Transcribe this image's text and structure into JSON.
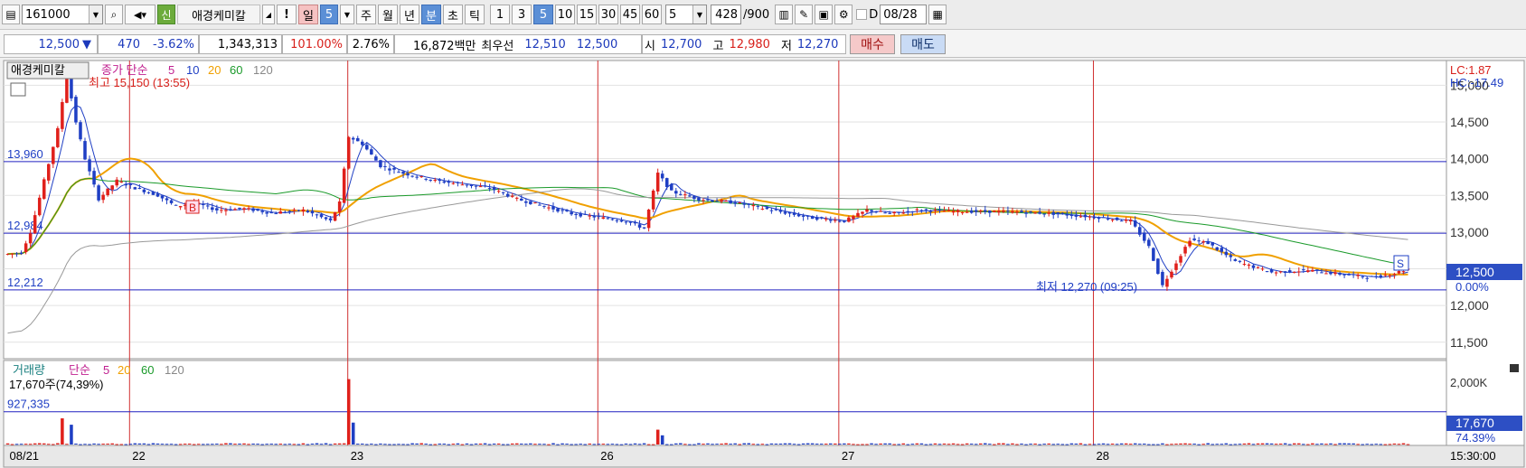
{
  "toolbar": {
    "stock_code": "161000",
    "stock_name": "애경케미칼",
    "badge_letter": "신",
    "alert": "!",
    "periods": [
      "일",
      "5",
      "주",
      "월",
      "년",
      "분",
      "초",
      "틱"
    ],
    "period_selected": "분",
    "intervals": [
      "1",
      "3",
      "5",
      "10",
      "15",
      "30",
      "45",
      "60"
    ],
    "interval_selected": "5",
    "count": "5",
    "range": "428",
    "range_total": "/900",
    "check_label": "D",
    "date": "08/28"
  },
  "quote": {
    "price": "12,500",
    "arrow": "▼",
    "change": "470",
    "change_pct": "-3.62%",
    "volume": "1,343,313",
    "vol_ratio": "101.00%",
    "turnover_pct": "2.76%",
    "amount": "16,872백만",
    "best_label": "최우선",
    "best_ask": "12,510",
    "best_bid": "12,500",
    "open_label": "시",
    "open": "12,700",
    "high_label": "고",
    "high": "12,980",
    "low_label": "저",
    "low": "12,270",
    "buy_label": "매수",
    "sell_label": "매도"
  },
  "chart_data": {
    "type": "candlestick",
    "legend_price": {
      "name": "애경케미칼",
      "ma_label": "종가 단순",
      "periods": [
        "5",
        "10",
        "20",
        "60",
        "120"
      ]
    },
    "legend_volume": {
      "name": "거래량",
      "ma_label": "단순",
      "periods": [
        "5",
        "20",
        "60",
        "120"
      ]
    },
    "volume_info": "17,670주(74,39%)",
    "ylim": [
      11300,
      15300
    ],
    "y_ticks": [
      11500,
      12000,
      12500,
      13000,
      13500,
      14000,
      14500,
      15000
    ],
    "y_tick_labels": [
      "11,500",
      "12,000",
      "12,500",
      "13,000",
      "13,500",
      "14,000",
      "14,500",
      "15,000"
    ],
    "vol_ylim": [
      0,
      2300000
    ],
    "vol_tick_label": "2,000K",
    "x_labels": [
      "08/21",
      "22",
      "23",
      "26",
      "27",
      "28"
    ],
    "time_label": "15:30:00",
    "h_lines": [
      {
        "value": 13960,
        "label": "13,960"
      },
      {
        "value": 12984,
        "label": "12,984"
      },
      {
        "value": 12212,
        "label": "12,212"
      }
    ],
    "vol_h_line": {
      "value": 927335,
      "label": "927,335"
    },
    "max_annotation": "최고 15,150 (13:55)",
    "min_annotation": "최저 12,270 (09:25)",
    "lc": "LC:1.87",
    "hc": "HC:-17.49",
    "last_price_tag": "12,500",
    "last_pct_tag": "0.00%",
    "last_vol_tag": "17,670",
    "last_vol_pct": "74.39%",
    "signal_b": "B",
    "signal_s": "S",
    "colors": {
      "up": "#e0201b",
      "down": "#1f3fc4",
      "ma5": "#1f3fc4",
      "ma20": "#f0a000",
      "ma60": "#1a9a2a",
      "ma120": "#999999",
      "hline": "#2020c0",
      "vline": "#d03030"
    },
    "anchors": [
      {
        "t": 0,
        "p": 12700
      },
      {
        "t": 3,
        "p": 12720
      },
      {
        "t": 5,
        "p": 13000
      },
      {
        "t": 8,
        "p": 13700
      },
      {
        "t": 11,
        "p": 14400
      },
      {
        "t": 13,
        "p": 15150
      },
      {
        "t": 15,
        "p": 14500
      },
      {
        "t": 17,
        "p": 14000
      },
      {
        "t": 20,
        "p": 13450
      },
      {
        "t": 24,
        "p": 13700
      },
      {
        "t": 28,
        "p": 13600
      },
      {
        "t": 33,
        "p": 13500
      },
      {
        "t": 37,
        "p": 13350
      },
      {
        "t": 41,
        "p": 13400
      },
      {
        "t": 46,
        "p": 13300
      },
      {
        "t": 52,
        "p": 13320
      },
      {
        "t": 58,
        "p": 13260
      },
      {
        "t": 65,
        "p": 13300
      },
      {
        "t": 71,
        "p": 13150
      },
      {
        "t": 73,
        "p": 13400
      },
      {
        "t": 75,
        "p": 14300
      },
      {
        "t": 78,
        "p": 14200
      },
      {
        "t": 82,
        "p": 13900
      },
      {
        "t": 87,
        "p": 13800
      },
      {
        "t": 94,
        "p": 13700
      },
      {
        "t": 100,
        "p": 13650
      },
      {
        "t": 106,
        "p": 13600
      },
      {
        "t": 112,
        "p": 13450
      },
      {
        "t": 118,
        "p": 13350
      },
      {
        "t": 124,
        "p": 13250
      },
      {
        "t": 130,
        "p": 13200
      },
      {
        "t": 136,
        "p": 13150
      },
      {
        "t": 140,
        "p": 13050
      },
      {
        "t": 143,
        "p": 13800
      },
      {
        "t": 146,
        "p": 13550
      },
      {
        "t": 152,
        "p": 13450
      },
      {
        "t": 160,
        "p": 13400
      },
      {
        "t": 168,
        "p": 13300
      },
      {
        "t": 176,
        "p": 13200
      },
      {
        "t": 184,
        "p": 13150
      },
      {
        "t": 189,
        "p": 13300
      },
      {
        "t": 194,
        "p": 13250
      },
      {
        "t": 200,
        "p": 13300
      },
      {
        "t": 210,
        "p": 13280
      },
      {
        "t": 220,
        "p": 13280
      },
      {
        "t": 230,
        "p": 13250
      },
      {
        "t": 240,
        "p": 13200
      },
      {
        "t": 247,
        "p": 13150
      },
      {
        "t": 251,
        "p": 12800
      },
      {
        "t": 254,
        "p": 12270
      },
      {
        "t": 260,
        "p": 12900
      },
      {
        "t": 264,
        "p": 12850
      },
      {
        "t": 270,
        "p": 12600
      },
      {
        "t": 278,
        "p": 12450
      },
      {
        "t": 286,
        "p": 12480
      },
      {
        "t": 294,
        "p": 12420
      },
      {
        "t": 300,
        "p": 12380
      },
      {
        "t": 305,
        "p": 12440
      },
      {
        "t": 308,
        "p": 12500
      }
    ],
    "volume_spikes": [
      {
        "t": 12,
        "v": 740000
      },
      {
        "t": 14,
        "v": 560000
      },
      {
        "t": 75,
        "v": 1850000
      },
      {
        "t": 76,
        "v": 620000
      },
      {
        "t": 143,
        "v": 420000
      },
      {
        "t": 144,
        "v": 260000
      }
    ],
    "day_starts": [
      0,
      27,
      75,
      130,
      183,
      239
    ],
    "total_bars": 309
  }
}
